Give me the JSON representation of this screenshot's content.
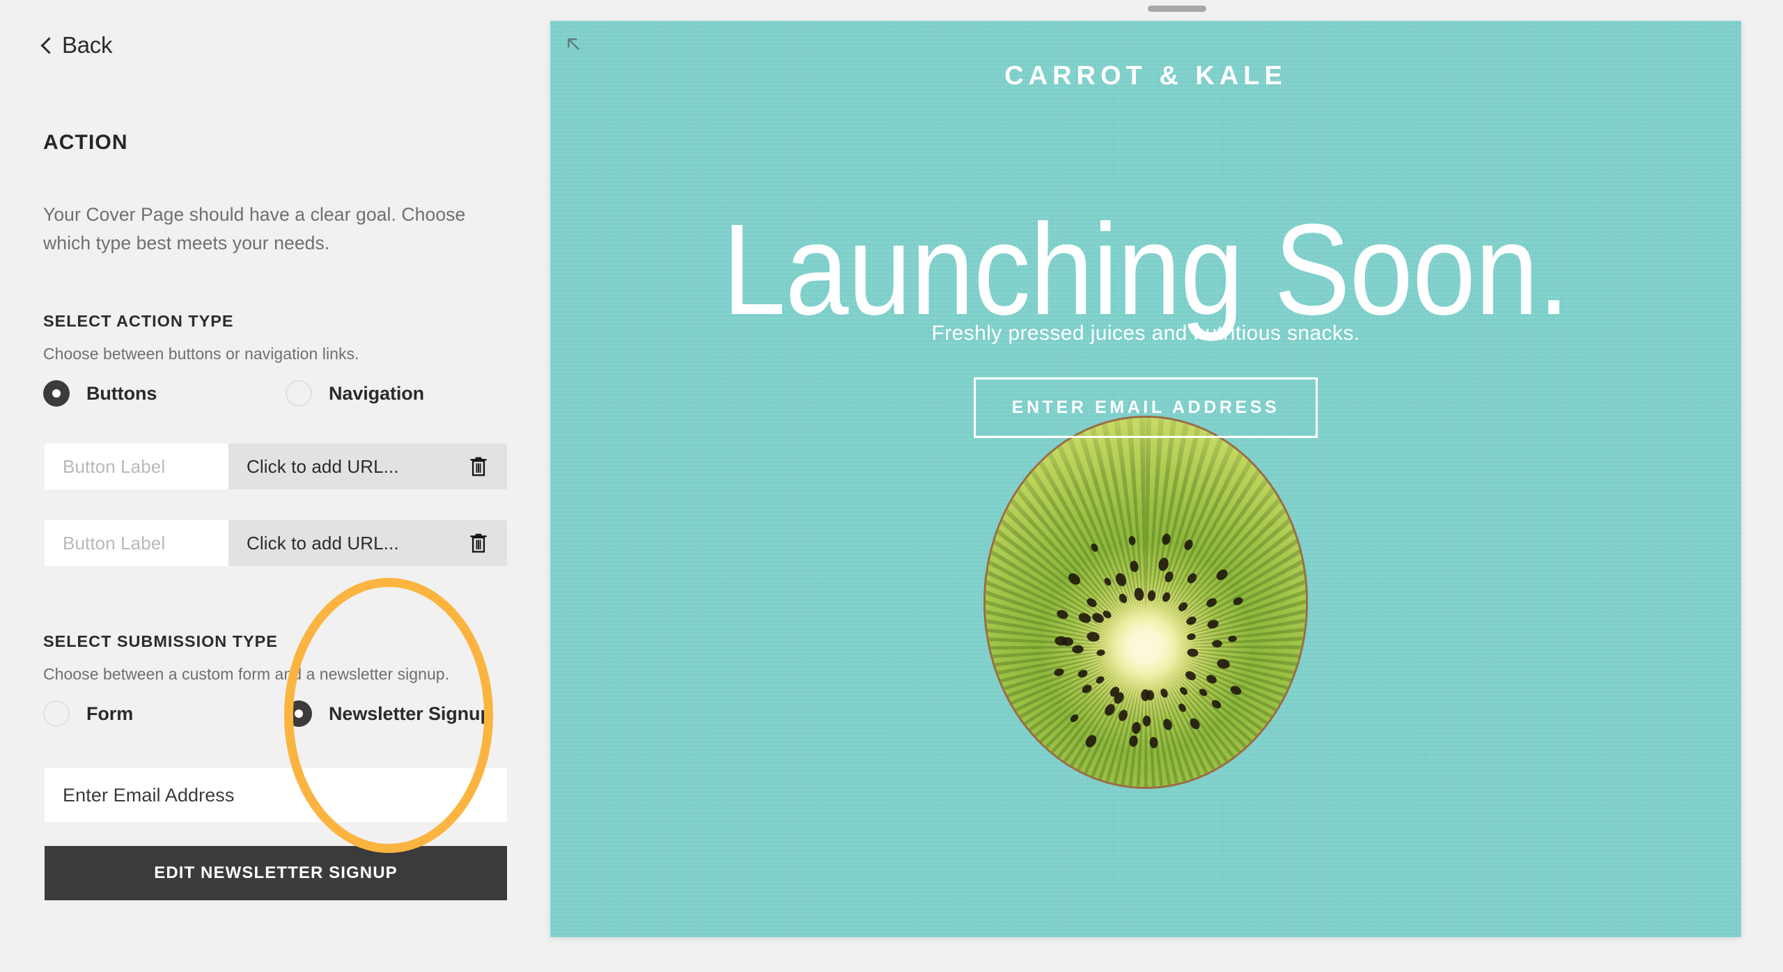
{
  "editor": {
    "back_label": "Back",
    "section_title": "ACTION",
    "section_description": "Your Cover Page should have a clear goal. Choose which type best meets your needs.",
    "action_type": {
      "label": "SELECT ACTION TYPE",
      "help": "Choose between buttons or navigation links.",
      "options": [
        {
          "label": "Buttons",
          "selected": true
        },
        {
          "label": "Navigation",
          "selected": false
        }
      ]
    },
    "button_rows": [
      {
        "label_placeholder": "Button Label",
        "url_text": "Click to add URL...",
        "delete_icon": "trash-icon"
      },
      {
        "label_placeholder": "Button Label",
        "url_text": "Click to add URL...",
        "delete_icon": "trash-icon"
      }
    ],
    "submission_type": {
      "label": "SELECT SUBMISSION TYPE",
      "help": "Choose between a custom form and a newsletter signup.",
      "options": [
        {
          "label": "Form",
          "selected": false
        },
        {
          "label": "Newsletter Signup",
          "selected": true
        }
      ]
    },
    "email_field_value": "Enter Email Address",
    "edit_newsletter_button": "EDIT NEWSLETTER SIGNUP",
    "highlight_color": "#fbb440"
  },
  "preview": {
    "background_color": "#7fd2cd",
    "brand_title": "CARROT & KALE",
    "headline": "Launching Soon.",
    "tagline": "Freshly pressed juices and nutritious snacks.",
    "cta_label": "ENTER EMAIL ADDRESS",
    "expand_icon": "expand-arrow-icon",
    "drag_handle_icon": "drag-handle",
    "image_alt": "kiwi-slice-photo"
  }
}
